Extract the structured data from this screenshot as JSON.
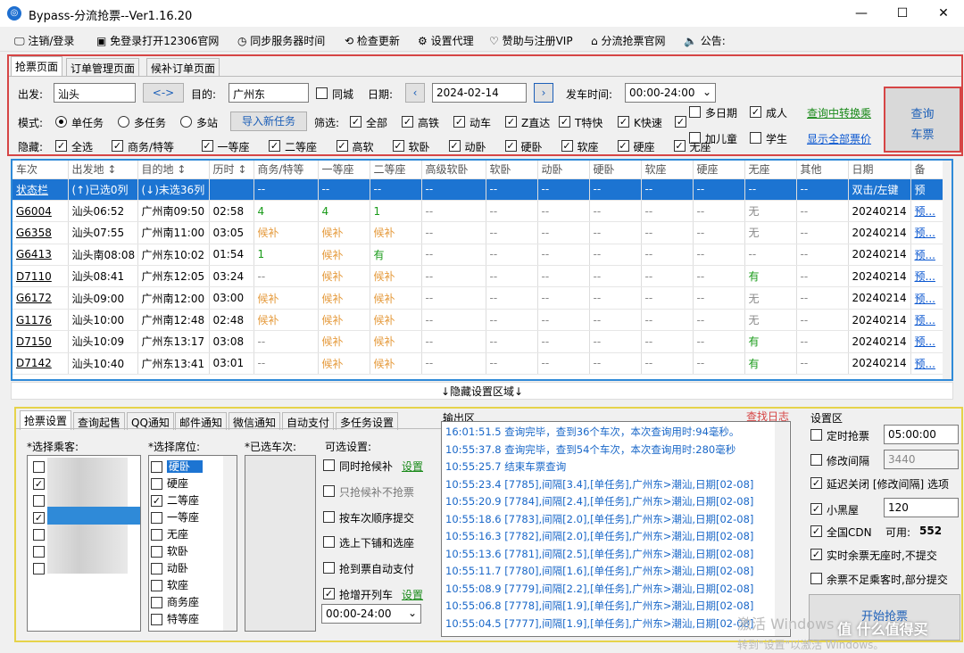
{
  "app": {
    "title": "Bypass-分流抢票--Ver1.16.20"
  },
  "window": {
    "min": "—",
    "max": "☐",
    "close": "✕"
  },
  "menu": [
    "注销/登录",
    "免登录打开12306官网",
    "同步服务器时间",
    "检查更新",
    "设置代理",
    "赞助与注册VIP",
    "分流抢票官网",
    "公告:"
  ],
  "top_tabs": [
    "抢票页面",
    "订单管理页面",
    "候补订单页面"
  ],
  "form": {
    "from_label": "出发:",
    "from": "汕头",
    "swap": "<->",
    "to_label": "目的:",
    "to": "广州东",
    "same_city": "同城",
    "date_label": "日期:",
    "date": "2024-02-14",
    "time_label": "发车时间:",
    "time": "00:00-24:00",
    "mode_label": "模式:",
    "modes": [
      "单任务",
      "多任务",
      "多站"
    ],
    "import_btn": "导入新任务",
    "filter_label": "筛选:",
    "filters": [
      "全部",
      "高铁",
      "动车",
      "Z直达",
      "T特快",
      "K快速"
    ],
    "multi_date": "多日期",
    "adult": "成人",
    "add_child": "加儿童",
    "student": "学生",
    "convert_link": "查询中转换乘",
    "show_all_link": "显示全部票价",
    "hide_label": "隐藏:",
    "hide_items": [
      "全选",
      "商务/特等",
      "一等座",
      "二等座",
      "高软",
      "软卧",
      "动卧",
      "硬卧",
      "软座",
      "硬座",
      "无座"
    ],
    "query_btn_1": "查询",
    "query_btn_2": "车票"
  },
  "grid": {
    "headers": [
      "车次",
      "出发地 ↕",
      "目的地 ↕",
      "历时 ↕",
      "商务/特等",
      "一等座",
      "二等座",
      "高级软卧",
      "软卧",
      "动卧",
      "硬卧",
      "软座",
      "硬座",
      "无座",
      "其他",
      "日期",
      "备"
    ],
    "status_row": [
      "状态栏",
      "(↑)已选0列",
      "(↓)未选36列",
      "",
      "--",
      "--",
      "--",
      "--",
      "--",
      "--",
      "--",
      "--",
      "--",
      "--",
      "--",
      "双击/左键",
      "预"
    ],
    "rows": [
      [
        "G6004",
        "汕头06:52",
        "广州南09:50",
        "02:58",
        "4",
        "4",
        "1",
        "--",
        "--",
        "--",
        "--",
        "--",
        "--",
        "无",
        "--",
        "20240214",
        "预..."
      ],
      [
        "G6358",
        "汕头07:55",
        "广州南11:00",
        "03:05",
        "候补",
        "候补",
        "候补",
        "--",
        "--",
        "--",
        "--",
        "--",
        "--",
        "无",
        "--",
        "20240214",
        "预..."
      ],
      [
        "G6413",
        "汕头南08:08",
        "广州东10:02",
        "01:54",
        "1",
        "候补",
        "有",
        "--",
        "--",
        "--",
        "--",
        "--",
        "--",
        "--",
        "--",
        "20240214",
        "预..."
      ],
      [
        "D7110",
        "汕头08:41",
        "广州东12:05",
        "03:24",
        "--",
        "候补",
        "候补",
        "--",
        "--",
        "--",
        "--",
        "--",
        "--",
        "有",
        "--",
        "20240214",
        "预..."
      ],
      [
        "G6172",
        "汕头09:00",
        "广州南12:00",
        "03:00",
        "候补",
        "候补",
        "候补",
        "--",
        "--",
        "--",
        "--",
        "--",
        "--",
        "无",
        "--",
        "20240214",
        "预..."
      ],
      [
        "G1176",
        "汕头10:00",
        "广州南12:48",
        "02:48",
        "候补",
        "候补",
        "候补",
        "--",
        "--",
        "--",
        "--",
        "--",
        "--",
        "无",
        "--",
        "20240214",
        "预..."
      ],
      [
        "D7150",
        "汕头10:09",
        "广州东13:17",
        "03:08",
        "--",
        "候补",
        "候补",
        "--",
        "--",
        "--",
        "--",
        "--",
        "--",
        "有",
        "--",
        "20240214",
        "预..."
      ],
      [
        "D7142",
        "汕头10:40",
        "广州东13:41",
        "03:01",
        "--",
        "候补",
        "候补",
        "--",
        "--",
        "--",
        "--",
        "--",
        "--",
        "有",
        "--",
        "20240214",
        "预..."
      ]
    ]
  },
  "hide_bar": "↓隐藏设置区域↓",
  "bottom_tabs": [
    "抢票设置",
    "查询起售",
    "QQ通知",
    "邮件通知",
    "微信通知",
    "自动支付",
    "多任务设置"
  ],
  "passenger_label": "*选择乘客:",
  "seat_label": "*选择席位:",
  "seats": [
    "硬卧",
    "硬座",
    "二等座",
    "一等座",
    "无座",
    "软卧",
    "动卧",
    "软座",
    "商务座",
    "特等座"
  ],
  "seats_checked": [
    false,
    false,
    true,
    false,
    false,
    false,
    false,
    false,
    false,
    false
  ],
  "selected_trains_label": "*已选车次:",
  "options_label": "可选设置:",
  "options": [
    "同时抢候补",
    "只抢候补不抢票",
    "按车次顺序提交",
    "选上下铺和选座",
    "抢到票自动支付",
    "抢增开列车"
  ],
  "options_checked": [
    false,
    false,
    false,
    false,
    false,
    true
  ],
  "settings_link": "设置",
  "opt_time": "00:00-24:00",
  "output_label": "输出区",
  "log_link": "查找日志",
  "log": [
    "16:01:51.5  查询完毕，查到36个车次，本次查询用时:94毫秒。",
    "10:55:37.8  查询完毕，查到54个车次，本次查询用时:280毫秒",
    "",
    "10:55:25.7  结束车票查询",
    "10:55:23.4  [7785],间隔[3.4],[单任务],广州东>潮汕,日期[02-08]",
    "10:55:20.9  [7784],间隔[2.4],[单任务],广州东>潮汕,日期[02-08]",
    "10:55:18.6  [7783],间隔[2.0],[单任务],广州东>潮汕,日期[02-08]",
    "10:55:16.3  [7782],间隔[2.0],[单任务],广州东>潮汕,日期[02-08]",
    "10:55:13.6  [7781],间隔[2.5],[单任务],广州东>潮汕,日期[02-08]",
    "10:55:11.7  [7780],间隔[1.6],[单任务],广州东>潮汕,日期[02-08]",
    "10:55:08.9  [7779],间隔[2.2],[单任务],广州东>潮汕,日期[02-08]",
    "10:55:06.8  [7778],间隔[1.9],[单任务],广州东>潮汕,日期[02-08]",
    "10:55:04.5  [7777],间隔[1.9],[单任务],广州东>潮汕,日期[02-08]"
  ],
  "settings": {
    "label": "设置区",
    "timed": "定时抢票",
    "timed_val": "05:00:00",
    "interval": "修改间隔",
    "interval_val": "3440",
    "delay": "延迟关闭",
    "delay_link": "[修改间隔]",
    "delay_opt": "选项",
    "blackroom": "小黑屋",
    "blackroom_val": "120",
    "cdn": "全国CDN",
    "cdn_avail": "可用:",
    "cdn_count": "552",
    "realtime": "实时余票无座时,不提交",
    "partial": "余票不足乘客时,部分提交",
    "start_btn": "开始抢票"
  },
  "watermark": {
    "line1": "激活 Windows",
    "line2": "转到\"设置\"以激活 Windows。",
    "brand": "值 什么值得买"
  }
}
